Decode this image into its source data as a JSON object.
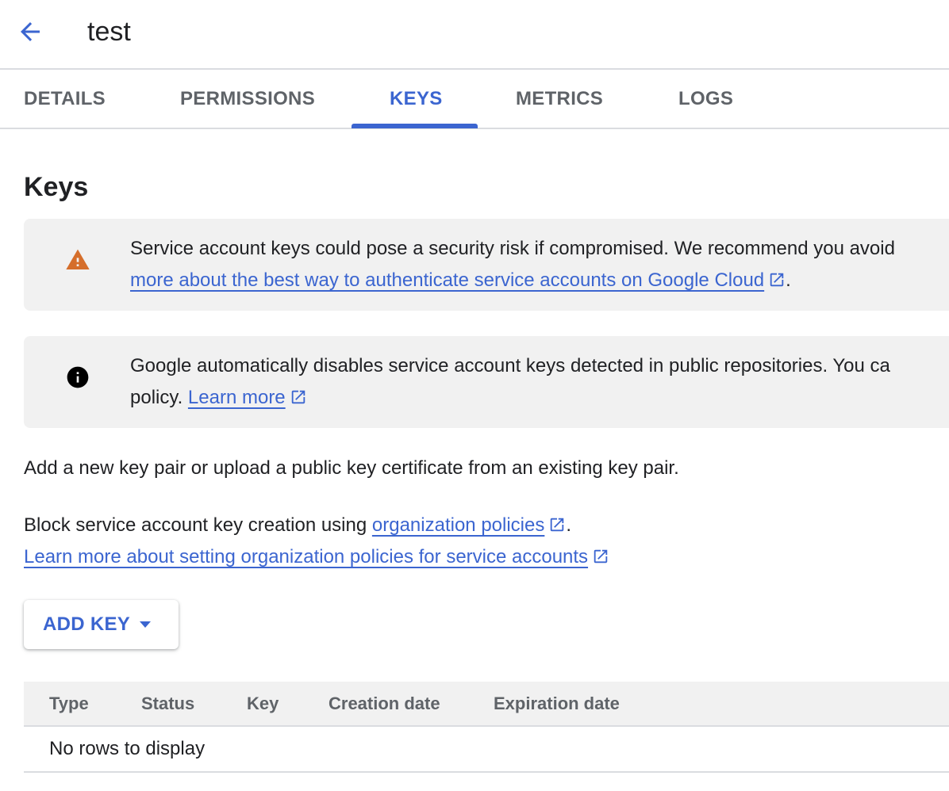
{
  "header": {
    "title": "test",
    "back_icon": "arrow-back-icon"
  },
  "tabs": [
    {
      "label": "DETAILS",
      "active": false
    },
    {
      "label": "PERMISSIONS",
      "active": false
    },
    {
      "label": "KEYS",
      "active": true
    },
    {
      "label": "METRICS",
      "active": false
    },
    {
      "label": "LOGS",
      "active": false
    }
  ],
  "section": {
    "title": "Keys"
  },
  "warning_callout": {
    "icon": "warning-icon",
    "line1": "Service account keys could pose a security risk if compromised. We recommend you avoid",
    "link": "more about the best way to authenticate service accounts on Google Cloud",
    "suffix": "."
  },
  "info_callout": {
    "icon": "info-icon",
    "line1": "Google automatically disables service account keys detected in public repositories. You ca",
    "line2_prefix": "policy.",
    "link": "Learn more"
  },
  "intro_text": "Add a new key pair or upload a public key certificate from an existing key pair.",
  "org_policy": {
    "prefix": "Block service account key creation using",
    "link": "organization policies",
    "suffix": ".",
    "learn_more_link": "Learn more about setting organization policies for service accounts"
  },
  "add_key_button": {
    "label": "ADD KEY",
    "icon": "caret-down-icon"
  },
  "table": {
    "columns": [
      "Type",
      "Status",
      "Key",
      "Creation date",
      "Expiration date"
    ],
    "empty_message": "No rows to display"
  },
  "colors": {
    "accent": "#3b65d0",
    "warning": "#d56e2b",
    "callout_bg": "#f1f1f1",
    "divider": "#dadce0"
  }
}
